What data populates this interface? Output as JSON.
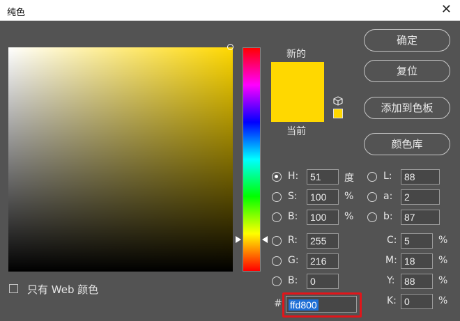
{
  "window": {
    "title": "纯色",
    "close": "✕"
  },
  "preview": {
    "new_label": "新的",
    "current_label": "当前",
    "color": "#ffd800"
  },
  "buttons": {
    "ok": "确定",
    "reset": "复位",
    "add_swatch": "添加到色板",
    "color_libraries": "颜色库"
  },
  "hsb": {
    "h": {
      "label": "H:",
      "value": "51",
      "unit": "度"
    },
    "s": {
      "label": "S:",
      "value": "100",
      "unit": "%"
    },
    "b": {
      "label": "B:",
      "value": "100",
      "unit": "%"
    }
  },
  "rgb": {
    "r": {
      "label": "R:",
      "value": "255"
    },
    "g": {
      "label": "G:",
      "value": "216"
    },
    "b": {
      "label": "B:",
      "value": "0"
    }
  },
  "lab": {
    "l": {
      "label": "L:",
      "value": "88"
    },
    "a": {
      "label": "a:",
      "value": "2"
    },
    "b": {
      "label": "b:",
      "value": "87"
    }
  },
  "cmyk": {
    "c": {
      "label": "C:",
      "value": "5",
      "unit": "%"
    },
    "m": {
      "label": "M:",
      "value": "18",
      "unit": "%"
    },
    "y": {
      "label": "Y:",
      "value": "88",
      "unit": "%"
    },
    "k": {
      "label": "K:",
      "value": "0",
      "unit": "%"
    }
  },
  "hex": {
    "prefix": "#",
    "value": "ffd800"
  },
  "web_only": {
    "label": "只有 Web 颜色",
    "checked": false
  },
  "selected_radio": "H",
  "colors": {
    "accent_highlight": "#e2151a",
    "selection": "#1e6fd6"
  }
}
